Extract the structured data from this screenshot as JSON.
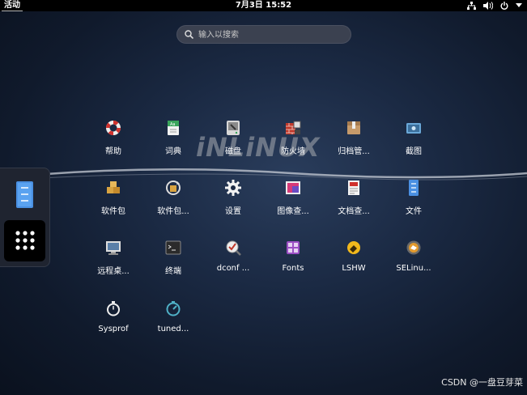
{
  "topbar": {
    "activities": "活动",
    "clock": "7月3日  15:52",
    "tray_icons": [
      "network-icon",
      "volume-icon",
      "power-icon",
      "chevron-down-icon"
    ]
  },
  "search": {
    "placeholder": "输入以搜索",
    "value": ""
  },
  "watermark": "iNLiNUX",
  "dash": {
    "items": [
      "files-icon",
      "show-apps-icon"
    ]
  },
  "apps": [
    {
      "label": "帮助",
      "icon": "help-lifebuoy-icon"
    },
    {
      "label": "词典",
      "icon": "dictionary-icon"
    },
    {
      "label": "磁盘",
      "icon": "disks-icon"
    },
    {
      "label": "防火墙",
      "icon": "firewall-icon"
    },
    {
      "label": "归档管...",
      "icon": "archive-manager-icon"
    },
    {
      "label": "截图",
      "icon": "screenshot-icon"
    },
    {
      "label": "软件包",
      "icon": "software-package-icon"
    },
    {
      "label": "软件包...",
      "icon": "package-updater-icon"
    },
    {
      "label": "设置",
      "icon": "settings-gear-icon"
    },
    {
      "label": "图像查...",
      "icon": "image-viewer-icon"
    },
    {
      "label": "文档查...",
      "icon": "document-viewer-icon"
    },
    {
      "label": "文件",
      "icon": "files-icon"
    },
    {
      "label": "远程桌...",
      "icon": "remote-desktop-icon"
    },
    {
      "label": "终端",
      "icon": "terminal-icon"
    },
    {
      "label": "dconf ...",
      "icon": "dconf-editor-icon"
    },
    {
      "label": "Fonts",
      "icon": "fonts-icon"
    },
    {
      "label": "LSHW",
      "icon": "lshw-icon"
    },
    {
      "label": "SELinu...",
      "icon": "selinux-icon"
    },
    {
      "label": "Sysprof",
      "icon": "sysprof-stopwatch-icon"
    },
    {
      "label": "tuned...",
      "icon": "tuned-icon"
    }
  ],
  "credit": "CSDN @一盘豆芽菜"
}
